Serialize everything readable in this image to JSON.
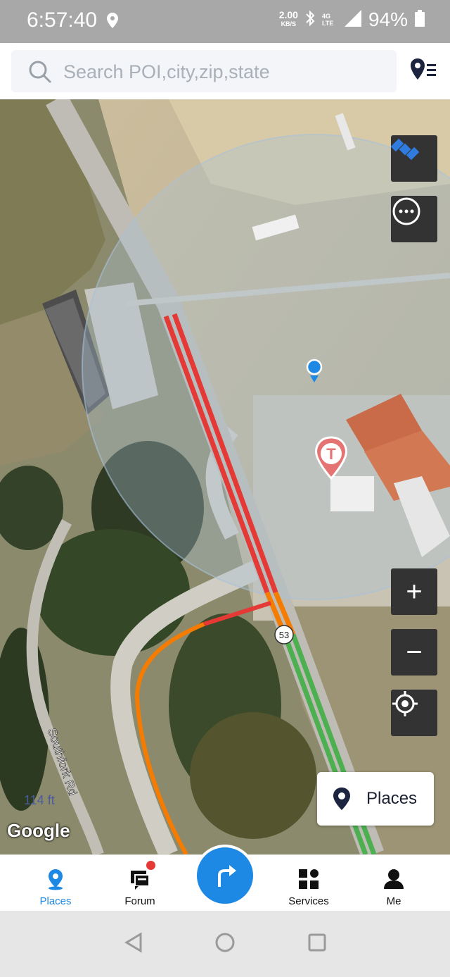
{
  "status_bar": {
    "time": "6:57:40",
    "net_speed_value": "2.00",
    "net_speed_unit": "KB/S",
    "network": "4G LTE",
    "battery": "94%",
    "icons": [
      "location-icon",
      "bluetooth-icon",
      "signal-icon",
      "battery-icon"
    ]
  },
  "search": {
    "placeholder": "Search POI,city,zip,state"
  },
  "map": {
    "provider_logo": "Google",
    "road_label": "Southfork Rd",
    "route_shield": "53",
    "poi_marker_letter": "T",
    "scale_text": "114 ft",
    "layer_button": "satellite-icon",
    "more_button": "more-icon",
    "zoom_in": "+",
    "zoom_out": "−",
    "locate_button": "locate-icon",
    "traffic_colors": {
      "heavy": "#e53935",
      "moderate": "#f57c00",
      "free": "#4caf50"
    }
  },
  "places_button": {
    "label": "Places"
  },
  "bottom_nav": [
    {
      "label": "Places",
      "icon": "places-icon",
      "active": true
    },
    {
      "label": "Forum",
      "icon": "forum-icon",
      "active": false,
      "has_badge": true
    },
    {
      "label": "Services",
      "icon": "services-icon",
      "active": false
    },
    {
      "label": "Me",
      "icon": "person-icon",
      "active": false
    }
  ],
  "fab": {
    "icon": "turn-right-icon"
  },
  "colors": {
    "accent": "#1e88e5",
    "dark_button": "#333333"
  }
}
